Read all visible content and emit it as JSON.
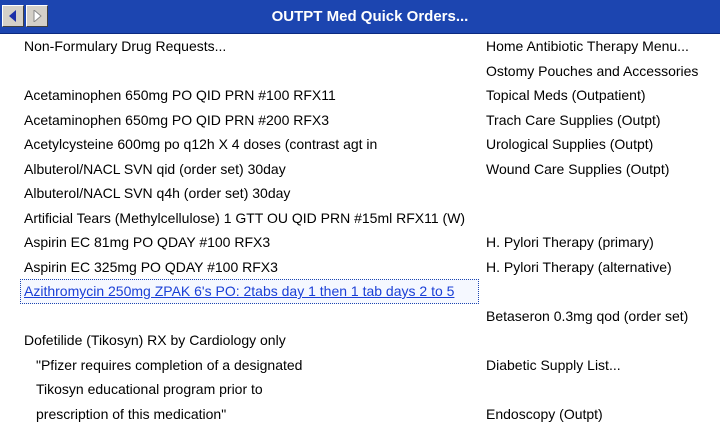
{
  "window": {
    "title": "OUTPT Med Quick Orders...",
    "back_icon": "triangle-left-icon",
    "forward_icon": "triangle-right-icon"
  },
  "left_items": [
    {
      "label": "Non-Formulary Drug Requests...",
      "indent": false,
      "selected": false
    },
    {
      "label": "",
      "indent": false,
      "selected": false
    },
    {
      "label": "Acetaminophen 650mg PO QID PRN #100 RFX11",
      "indent": false,
      "selected": false
    },
    {
      "label": "Acetaminophen 650mg PO QID PRN #200 RFX3",
      "indent": false,
      "selected": false
    },
    {
      "label": "Acetylcysteine 600mg po q12h X 4 doses (contrast agt in",
      "indent": false,
      "selected": false
    },
    {
      "label": "Albuterol/NACL SVN qid (order set) 30day",
      "indent": false,
      "selected": false
    },
    {
      "label": "Albuterol/NACL SVN q4h (order set) 30day",
      "indent": false,
      "selected": false
    },
    {
      "label": "Artificial Tears (Methylcellulose) 1 GTT OU QID PRN #15ml RFX11 (W)",
      "indent": false,
      "selected": false
    },
    {
      "label": "Aspirin EC 81mg PO QDAY #100 RFX3",
      "indent": false,
      "selected": false
    },
    {
      "label": "Aspirin EC 325mg PO QDAY #100 RFX3",
      "indent": false,
      "selected": false
    },
    {
      "label": "Azithromycin 250mg ZPAK 6's PO: 2tabs day 1 then 1 tab days 2 to 5",
      "indent": false,
      "selected": true
    },
    {
      "label": "",
      "indent": false,
      "selected": false
    },
    {
      "label": "Dofetilide (Tikosyn) RX by Cardiology only",
      "indent": false,
      "selected": false
    },
    {
      "label": "\"Pfizer requires completion of a designated",
      "indent": true,
      "selected": false
    },
    {
      "label": "Tikosyn educational program prior to",
      "indent": true,
      "selected": false
    },
    {
      "label": "prescription of this medication\"",
      "indent": true,
      "selected": false
    }
  ],
  "right_items": [
    {
      "label": "Home Antibiotic Therapy Menu..."
    },
    {
      "label": "Ostomy Pouches and Accessories"
    },
    {
      "label": "Topical Meds (Outpatient)"
    },
    {
      "label": "Trach Care Supplies (Outpt)"
    },
    {
      "label": "Urological Supplies (Outpt)"
    },
    {
      "label": "Wound Care Supplies (Outpt)"
    },
    {
      "label": ""
    },
    {
      "label": ""
    },
    {
      "label": "H. Pylori Therapy (primary)"
    },
    {
      "label": "H. Pylori Therapy (alternative)"
    },
    {
      "label": ""
    },
    {
      "label": "Betaseron 0.3mg qod (order set)"
    },
    {
      "label": ""
    },
    {
      "label": "Diabetic Supply List..."
    },
    {
      "label": ""
    },
    {
      "label": "Endoscopy (Outpt)"
    }
  ]
}
